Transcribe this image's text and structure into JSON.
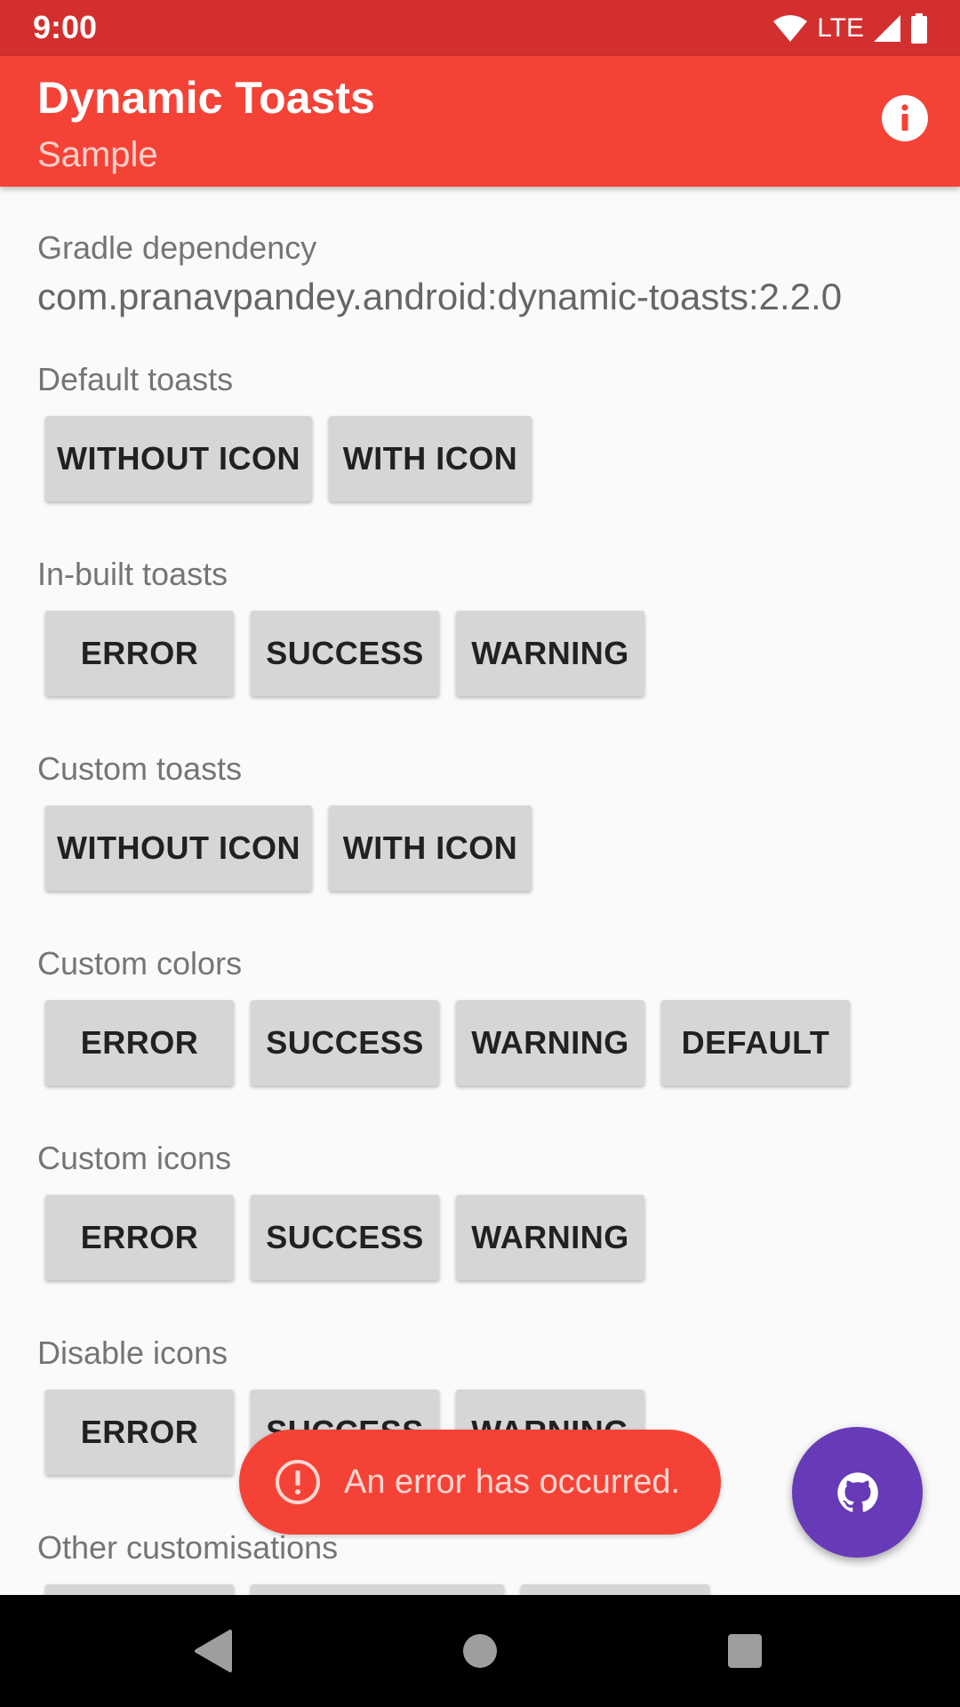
{
  "status_bar": {
    "time": "9:00",
    "network": "LTE"
  },
  "app_bar": {
    "title": "Dynamic Toasts",
    "subtitle": "Sample",
    "info_icon": "info-icon"
  },
  "gradle": {
    "label": "Gradle dependency",
    "value": "com.pranavpandey.android:dynamic-toasts:2.2.0"
  },
  "sections": {
    "default_toasts": {
      "label": "Default toasts",
      "buttons": [
        "WITHOUT ICON",
        "WITH ICON"
      ]
    },
    "inbuilt_toasts": {
      "label": "In-built toasts",
      "buttons": [
        "ERROR",
        "SUCCESS",
        "WARNING"
      ]
    },
    "custom_toasts": {
      "label": "Custom toasts",
      "buttons": [
        "WITHOUT ICON",
        "WITH ICON"
      ]
    },
    "custom_colors": {
      "label": "Custom colors",
      "buttons": [
        "ERROR",
        "SUCCESS",
        "WARNING",
        "DEFAULT"
      ]
    },
    "custom_icons": {
      "label": "Custom icons",
      "buttons": [
        "ERROR",
        "SUCCESS",
        "WARNING"
      ]
    },
    "disable_icons": {
      "label": "Disable icons",
      "buttons": [
        "ERROR",
        "SUCCESS",
        "WARNING"
      ]
    },
    "other_customisations": {
      "label": "Other customisations"
    }
  },
  "toast": {
    "icon": "error-icon",
    "text": "An error has occurred."
  },
  "fab": {
    "icon": "github-icon"
  },
  "colors": {
    "status_bar": "#d32f2f",
    "app_bar": "#f44336",
    "toast": "#f44336",
    "fab": "#673ab7",
    "button": "#d6d6d6"
  }
}
